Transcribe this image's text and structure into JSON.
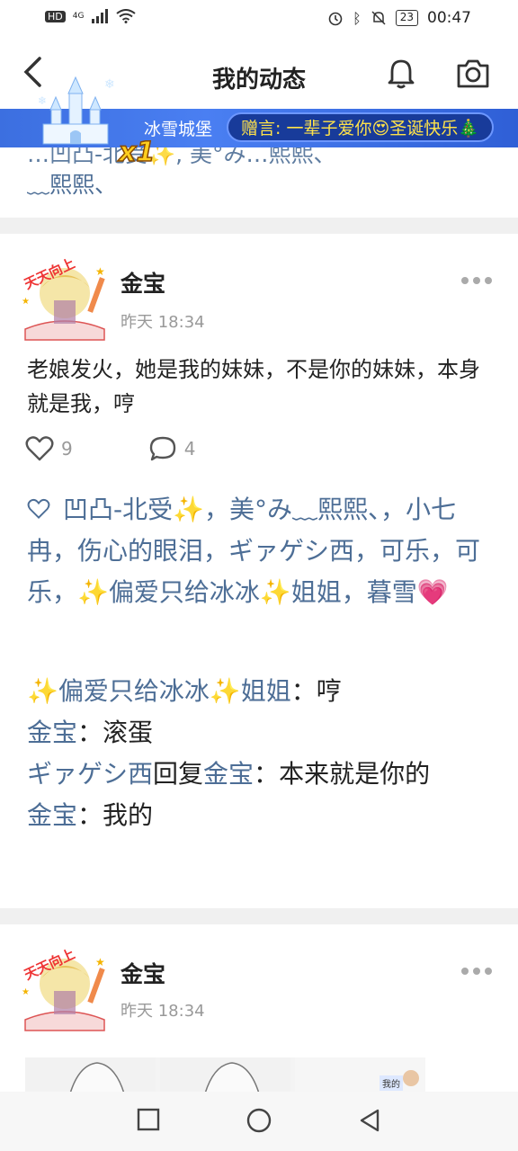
{
  "status_bar": {
    "network_left": "HD",
    "network_4g": "4G",
    "battery": "23",
    "time": "00:47"
  },
  "header": {
    "back_icon": "chevron-left-icon",
    "title": "我的动态",
    "bell_icon": "bell-icon",
    "camera_icon": "camera-icon"
  },
  "banner": {
    "badge": "x1",
    "sender": "冰雪城堡",
    "message": "赠言: 一辈子爱你😍圣诞快乐🎄"
  },
  "previous_post_tail": {
    "partial_line": "…凹凸-北受✨, 美°み…熙熙、",
    "line": "﹏熙熙、"
  },
  "posts": [
    {
      "username": "金宝",
      "time": "昨天 18:34",
      "text": "老娘发火，她是我的妹妹，不是你的妹妹，本身就是我，哼",
      "likes": "9",
      "comments": "4",
      "liked_by": "凹凸-北受✨，美°み﹏熙熙、，小七冉，伤心的眼泪，ギァゲシ西，可乐，可乐，✨偏爱只给冰冰✨姐姐，暮雪💗",
      "comment_list": [
        {
          "author": "✨偏爱只给冰冰✨姐姐",
          "sep": "：",
          "text": "哼",
          "reply_to": ""
        },
        {
          "author": "金宝",
          "sep": "：",
          "text": "滚蛋",
          "reply_to": ""
        },
        {
          "author": "ギァゲシ西",
          "reply_word": "回复",
          "reply_to": "金宝",
          "sep": "：",
          "text": "本来就是你的"
        },
        {
          "author": "金宝",
          "sep": "：",
          "text": "我的",
          "reply_to": ""
        }
      ]
    },
    {
      "username": "金宝",
      "time": "昨天 18:34"
    }
  ],
  "thumb_overlay_text": "我的",
  "colors": {
    "link": "#4d6e96",
    "banner": "#3c6fe0",
    "banner_text": "#ffe24a"
  }
}
